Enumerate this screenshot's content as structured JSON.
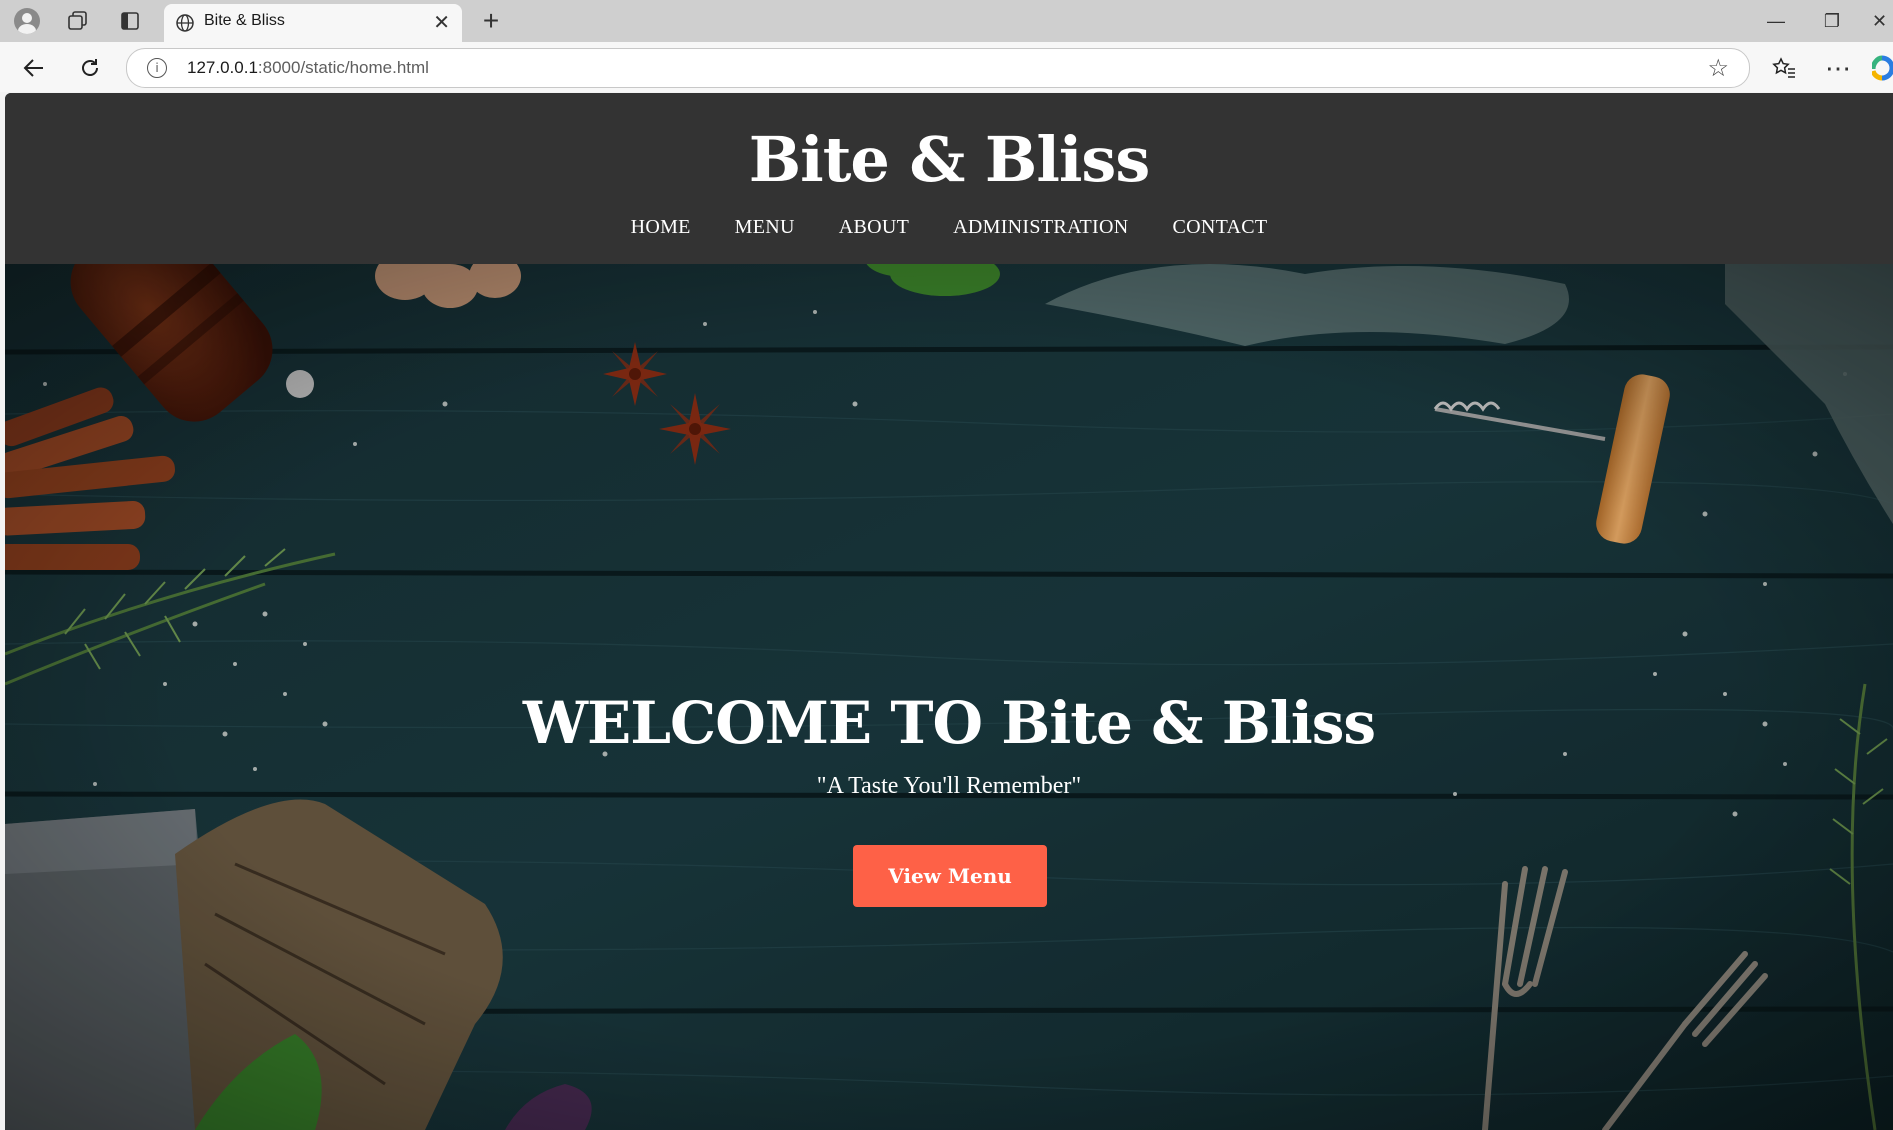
{
  "browser": {
    "tab_title": "Bite & Bliss",
    "url_host": "127.0.0.1",
    "url_path": ":8000/static/home.html",
    "icons": [
      "profile-icon",
      "workspaces-icon",
      "tab-actions-icon",
      "globe-icon",
      "close-icon",
      "plus-icon",
      "minimize-icon",
      "restore-icon",
      "back-icon",
      "refresh-icon",
      "info-icon",
      "star-icon",
      "favorites-icon",
      "more-icon",
      "copilot-icon"
    ]
  },
  "site": {
    "brand": "Bite & Bliss",
    "nav": [
      "HOME",
      "MENU",
      "ABOUT",
      "ADMINISTRATION",
      "CONTACT"
    ],
    "header_color": "#333333"
  },
  "hero": {
    "title": "WELCOME TO Bite & Bliss",
    "tagline": "\"A Taste You'll Remember\"",
    "cta_label": "View Menu",
    "cta_color": "#fe6147",
    "background": "dark teal wooden table with spices, herbs and cutlery"
  }
}
